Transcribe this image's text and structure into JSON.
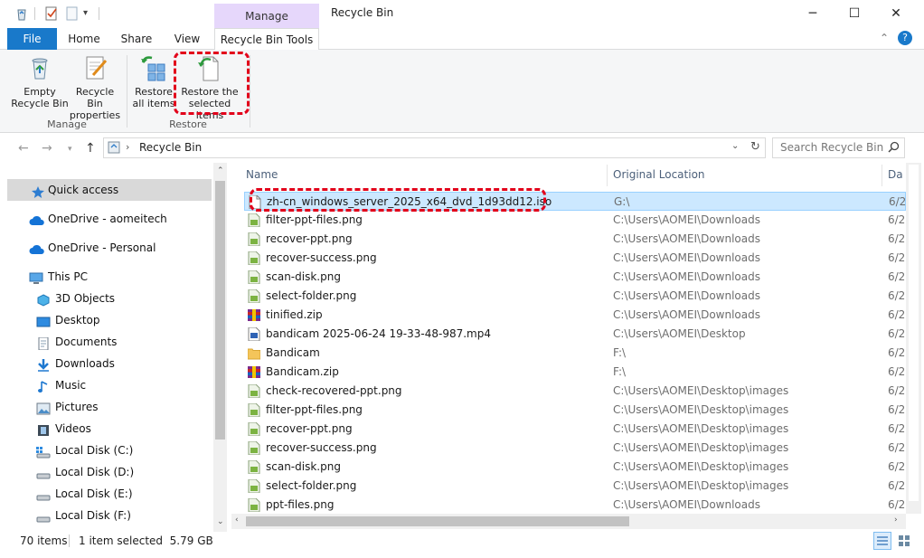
{
  "window": {
    "title": "Recycle Bin",
    "contextual_group": "Manage",
    "minimize": "─",
    "maximize": "☐",
    "close": "✕"
  },
  "tabs": [
    "File",
    "Home",
    "Share",
    "View",
    "Recycle Bin Tools"
  ],
  "ribbon": {
    "empty_bin_line1": "Empty",
    "empty_bin_line2": "Recycle Bin",
    "properties_line1": "Recycle Bin",
    "properties_line2": "properties",
    "restore_all_line1": "Restore",
    "restore_all_line2": "all items",
    "restore_selected_line1": "Restore the",
    "restore_selected_line2": "selected items",
    "group_manage": "Manage",
    "group_restore": "Restore"
  },
  "address": {
    "path": "Recycle Bin",
    "search_placeholder": "Search Recycle Bin"
  },
  "nav": {
    "quick_access": "Quick access",
    "onedrive_aomeitech": "OneDrive - aomeitech",
    "onedrive_personal": "OneDrive - Personal",
    "this_pc": "This PC",
    "objects3d": "3D Objects",
    "desktop": "Desktop",
    "documents": "Documents",
    "downloads": "Downloads",
    "music": "Music",
    "pictures": "Pictures",
    "videos": "Videos",
    "disk_c": "Local Disk (C:)",
    "disk_d": "Local Disk (D:)",
    "disk_e": "Local Disk (E:)",
    "disk_f": "Local Disk (F:)"
  },
  "columns": {
    "name": "Name",
    "original_location": "Original Location",
    "date": "Da"
  },
  "files": [
    {
      "name": "zh-cn_windows_server_2025_x64_dvd_1d93dd12.iso",
      "location": "G:\\",
      "date": "6/2",
      "type": "iso"
    },
    {
      "name": "filter-ppt-files.png",
      "location": "C:\\Users\\AOMEI\\Downloads",
      "date": "6/2",
      "type": "png"
    },
    {
      "name": "recover-ppt.png",
      "location": "C:\\Users\\AOMEI\\Downloads",
      "date": "6/2",
      "type": "png"
    },
    {
      "name": "recover-success.png",
      "location": "C:\\Users\\AOMEI\\Downloads",
      "date": "6/2",
      "type": "png"
    },
    {
      "name": "scan-disk.png",
      "location": "C:\\Users\\AOMEI\\Downloads",
      "date": "6/2",
      "type": "png"
    },
    {
      "name": "select-folder.png",
      "location": "C:\\Users\\AOMEI\\Downloads",
      "date": "6/2",
      "type": "png"
    },
    {
      "name": "tinified.zip",
      "location": "C:\\Users\\AOMEI\\Downloads",
      "date": "6/2",
      "type": "zip"
    },
    {
      "name": "bandicam 2025-06-24 19-33-48-987.mp4",
      "location": "C:\\Users\\AOMEI\\Desktop",
      "date": "6/2",
      "type": "mp4"
    },
    {
      "name": "Bandicam",
      "location": "F:\\",
      "date": "6/2",
      "type": "folder"
    },
    {
      "name": "Bandicam.zip",
      "location": "F:\\",
      "date": "6/2",
      "type": "zip"
    },
    {
      "name": "check-recovered-ppt.png",
      "location": "C:\\Users\\AOMEI\\Desktop\\images",
      "date": "6/2",
      "type": "png"
    },
    {
      "name": "filter-ppt-files.png",
      "location": "C:\\Users\\AOMEI\\Desktop\\images",
      "date": "6/2",
      "type": "png"
    },
    {
      "name": "recover-ppt.png",
      "location": "C:\\Users\\AOMEI\\Desktop\\images",
      "date": "6/2",
      "type": "png"
    },
    {
      "name": "recover-success.png",
      "location": "C:\\Users\\AOMEI\\Desktop\\images",
      "date": "6/2",
      "type": "png"
    },
    {
      "name": "scan-disk.png",
      "location": "C:\\Users\\AOMEI\\Desktop\\images",
      "date": "6/2",
      "type": "png"
    },
    {
      "name": "select-folder.png",
      "location": "C:\\Users\\AOMEI\\Desktop\\images",
      "date": "6/2",
      "type": "png"
    },
    {
      "name": "ppt-files.png",
      "location": "C:\\Users\\AOMEI\\Downloads",
      "date": "6/2",
      "type": "png"
    }
  ],
  "status": {
    "count": "70 items",
    "selection": "1 item selected  5.79 GB"
  },
  "colors": {
    "file_tab": "#1979ca",
    "manage_context": "#e6d7fb",
    "selection": "#cce8ff",
    "highlight_outline": "#e2001a"
  }
}
